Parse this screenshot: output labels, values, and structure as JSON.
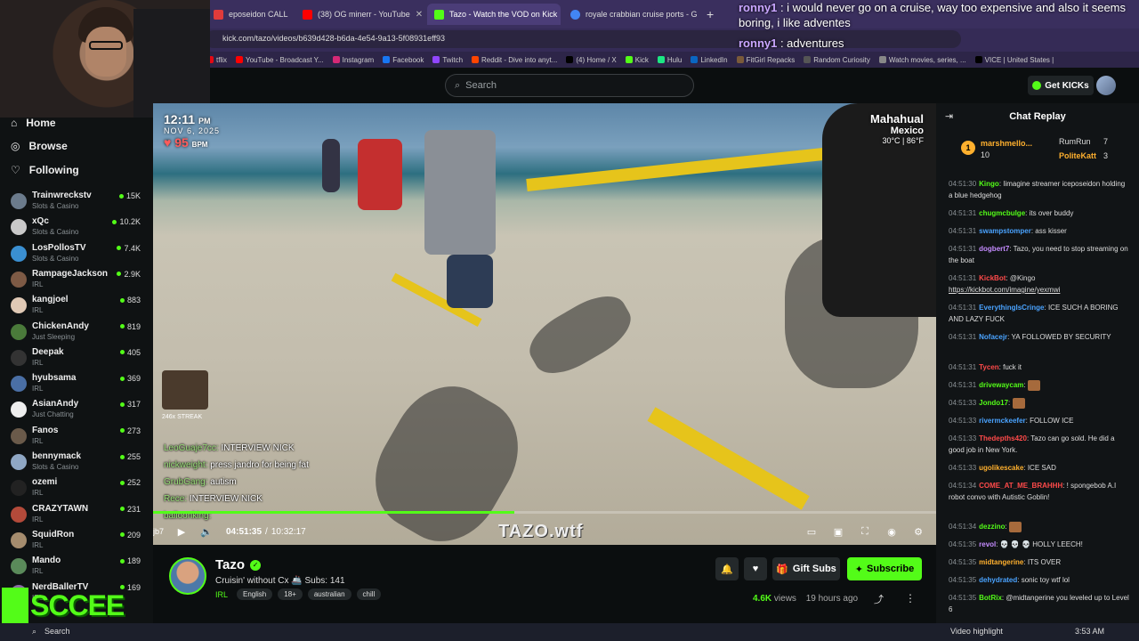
{
  "browser": {
    "tabs": [
      {
        "label": "eposeidon CALLS OUT T",
        "color": "#e03b3b"
      },
      {
        "label": "(38) OG minerr - YouTube",
        "color": "#ff0000"
      },
      {
        "label": "Tazo - Watch the VOD on Kick",
        "color": "#53fc18",
        "active": true
      },
      {
        "label": "royale crabbian cruise ports - G",
        "color": "#4285f4"
      }
    ],
    "url": "kick.com/tazo/videos/b639d428-b6da-4e54-9a13-5f08931eff93",
    "bookmarks": [
      {
        "label": "tflix",
        "color": "#e50914"
      },
      {
        "label": "YouTube - Broadcast Y...",
        "color": "#ff0000"
      },
      {
        "label": "Instagram",
        "color": "#d62976"
      },
      {
        "label": "Facebook",
        "color": "#1877f2"
      },
      {
        "label": "Twitch",
        "color": "#9146ff"
      },
      {
        "label": "Reddit - Dive into anyt...",
        "color": "#ff4500"
      },
      {
        "label": "(4) Home / X",
        "color": "#000000"
      },
      {
        "label": "Kick",
        "color": "#53fc18"
      },
      {
        "label": "Hulu",
        "color": "#1ce783"
      },
      {
        "label": "LinkedIn",
        "color": "#0a66c2"
      },
      {
        "label": "FitGirl Repacks",
        "color": "#7a5a3a"
      },
      {
        "label": "Random Curiosity",
        "color": "#555555"
      },
      {
        "label": "Watch movies, series, ...",
        "color": "#888888"
      },
      {
        "label": "VICE | United States |",
        "color": "#000000"
      }
    ]
  },
  "overlay_chat": [
    {
      "user": "ronny1",
      "text": " : i would never go on a cruise, way too expensive and also it seems boring, i like adventes"
    },
    {
      "user": "ronny1",
      "text": " : adventures"
    }
  ],
  "topbar": {
    "search_placeholder": "Search",
    "get_kicks": "Get KICKs"
  },
  "sidebar": {
    "nav": [
      {
        "label": "Home",
        "icon": "home-icon"
      },
      {
        "label": "Browse",
        "icon": "compass-icon"
      },
      {
        "label": "Following",
        "icon": "heart-icon"
      }
    ],
    "channels": [
      {
        "name": "Trainwreckstv",
        "category": "Slots & Casino",
        "viewers": "15K",
        "color": "#6b7b8c"
      },
      {
        "name": "xQc",
        "category": "Slots & Casino",
        "viewers": "10.2K",
        "color": "#c9c9c9"
      },
      {
        "name": "LosPollosTV",
        "category": "Slots & Casino",
        "viewers": "7.4K",
        "color": "#3a8fd1"
      },
      {
        "name": "RampageJackson",
        "category": "IRL",
        "viewers": "2.9K",
        "color": "#7d5a45"
      },
      {
        "name": "kangjoel",
        "category": "IRL",
        "viewers": "883",
        "color": "#e0c9b5"
      },
      {
        "name": "ChickenAndy",
        "category": "Just Sleeping",
        "viewers": "819",
        "color": "#4a7a3a"
      },
      {
        "name": "Deepak",
        "category": "IRL",
        "viewers": "405",
        "color": "#333333"
      },
      {
        "name": "hyubsama",
        "category": "IRL",
        "viewers": "369",
        "color": "#4a6fa5"
      },
      {
        "name": "AsianAndy",
        "category": "Just Chatting",
        "viewers": "317",
        "color": "#eeeeee"
      },
      {
        "name": "Fanos",
        "category": "IRL",
        "viewers": "273",
        "color": "#6a5a4a"
      },
      {
        "name": "bennymack",
        "category": "Slots & Casino",
        "viewers": "255",
        "color": "#8fa7c4"
      },
      {
        "name": "ozemi",
        "category": "IRL",
        "viewers": "252",
        "color": "#222222"
      },
      {
        "name": "CRAZYTAWN",
        "category": "IRL",
        "viewers": "231",
        "color": "#b34a3a"
      },
      {
        "name": "SquidRon",
        "category": "IRL",
        "viewers": "209",
        "color": "#a58c6e"
      },
      {
        "name": "Mando",
        "category": "IRL",
        "viewers": "189",
        "color": "#5a8a5a"
      },
      {
        "name": "NerdBallerTV",
        "category": "IRL",
        "viewers": "169",
        "color": "#8a6aa5"
      }
    ],
    "overlay_logo": "SCCEE"
  },
  "video": {
    "clock_time": "12:11",
    "clock_ampm": "PM",
    "date": "NOV 6, 2025",
    "bpm": "95",
    "bpm_unit": "BPM",
    "location_city": "Mahahual",
    "location_country": "Mexico",
    "temperature": "30°C | 86°F",
    "streak": "246x STREAK",
    "chat": [
      {
        "user": "LeoGuaje7cc:",
        "text": " INTERVIEW NICK"
      },
      {
        "user": "nickweight:",
        "text": " press jandro for being fat"
      },
      {
        "user": "GrubGang:",
        "text": " autism"
      },
      {
        "user": "Rece:",
        "text": " INTERVIEW NICK"
      },
      {
        "user": "balloonking:",
        "text": ""
      }
    ],
    "chat_partial": "jb7",
    "current_time": "04:51:35",
    "separator": "/",
    "duration": "10:32:17",
    "progress": 0.461,
    "watermark": "TAZO.wtf"
  },
  "streamer": {
    "name": "Tazo",
    "title": "Cruisin' without Cx 🚢 Subs: 141",
    "category": "IRL",
    "tags": [
      "English",
      "18+",
      "australian",
      "chill"
    ],
    "gift_subs": "Gift Subs",
    "subscribe": "Subscribe",
    "views_count": "4.6K",
    "views_label": "views",
    "ago": "19 hours ago"
  },
  "chat_replay": {
    "title": "Chat Replay",
    "leaders": [
      {
        "rank": "1",
        "name": "marshmello...",
        "count": "10"
      },
      {
        "rank": "",
        "name": "RumRun",
        "count": "7"
      },
      {
        "rank": "",
        "name": "PoliteKatt",
        "count": "3"
      }
    ],
    "messages": [
      {
        "time": "04:51:30",
        "user": "Kingo",
        "color": "#53fc18",
        "text": ": Iimagine streamer iceposeidon holding a blue hedgehog"
      },
      {
        "time": "04:51:31",
        "user": "chugmcbulge",
        "color": "#53fc18",
        "text": ": its over buddy"
      },
      {
        "time": "04:51:31",
        "user": "swampstomper",
        "color": "#4aa3ff",
        "text": ": ass kisser"
      },
      {
        "time": "04:51:31",
        "user": "dogbert7",
        "color": "#c58cff",
        "text": ": Tazo, you need to stop streaming on the boat"
      },
      {
        "time": "04:51:31",
        "user": "KickBot",
        "color": "#ff4a4a",
        "text": ": @Kingo ",
        "link": "https://kickbot.com/imagine/yexmwi"
      },
      {
        "time": "04:51:31",
        "user": "EverythingIsCringe",
        "color": "#4aa3ff",
        "text": ": ICE SUCH A BORING AND LAZY FUCK"
      },
      {
        "time": "04:51:31",
        "user": "Nofacejr",
        "color": "#4aa3ff",
        "text": ": YA FOLLOWED BY SECURITY"
      },
      {
        "time": "04:51:31",
        "user": "Tycen",
        "color": "#ff4a4a",
        "text": ": fuck it"
      },
      {
        "time": "04:51:31",
        "user": "drivewaycam",
        "color": "#53fc18",
        "text": ":"
      },
      {
        "time": "04:51:33",
        "user": "Jondo17",
        "color": "#53fc18",
        "text": ":"
      },
      {
        "time": "04:51:33",
        "user": "rivermckeefer",
        "color": "#4aa3ff",
        "text": ": FOLLOW ICE"
      },
      {
        "time": "04:51:33",
        "user": "Thedepths420",
        "color": "#ff4a4a",
        "text": ": Tazo can go sold. He did a good job in New York."
      },
      {
        "time": "04:51:33",
        "user": "ugolikescake",
        "color": "#ffb02e",
        "text": ": ICE SAD"
      },
      {
        "time": "04:51:34",
        "user": "COME_AT_ME_BRAHHH",
        "color": "#ff4a4a",
        "text": ": ! spongebob A.I robot convo with Autistic Goblin!"
      },
      {
        "time": "04:51:34",
        "user": "dezzino",
        "color": "#53fc18",
        "text": ":"
      },
      {
        "time": "04:51:35",
        "user": "revol",
        "color": "#c58cff",
        "text": ": 💀 💀 💀 HOLLY LEECH!"
      },
      {
        "time": "04:51:35",
        "user": "midtangerine",
        "color": "#ffb02e",
        "text": ": ITS OVER"
      },
      {
        "time": "04:51:35",
        "user": "dehydrated",
        "color": "#4aa3ff",
        "text": ": sonic toy wtf lol"
      },
      {
        "time": "04:51:35",
        "user": "BotRix",
        "color": "#53fc18",
        "text": ": @midtangerine you leveled up to Level 6"
      }
    ]
  },
  "taskbar": {
    "search": "Search",
    "video_highlight": "Video highlight",
    "time": "3:53 AM"
  }
}
